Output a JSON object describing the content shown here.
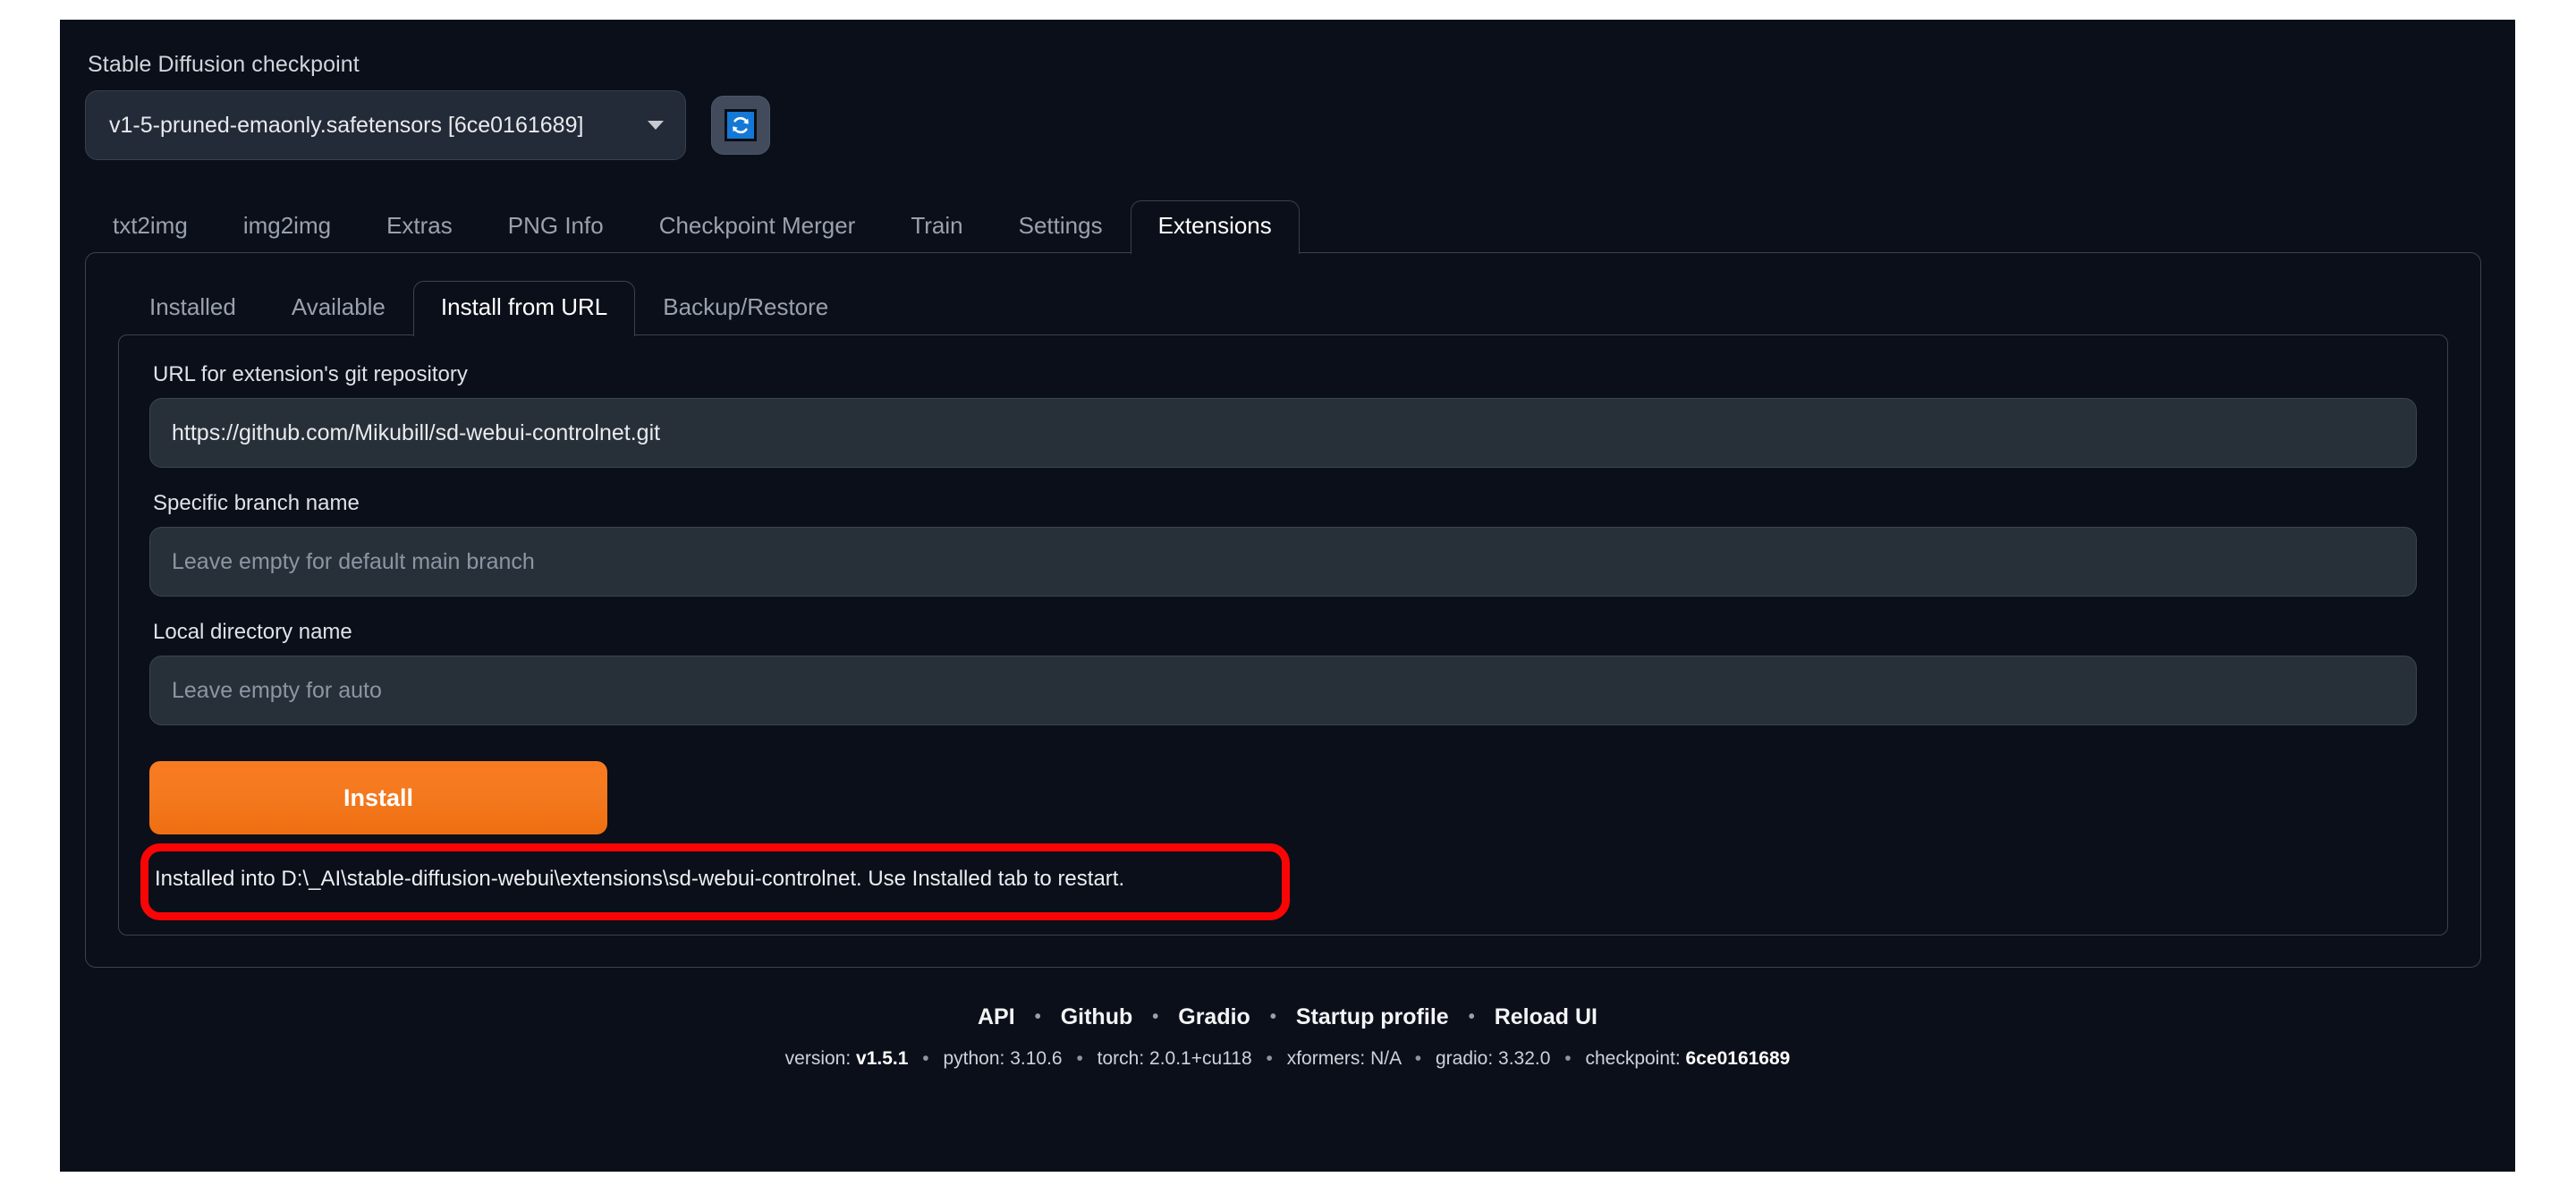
{
  "checkpoint": {
    "label": "Stable Diffusion checkpoint",
    "selected": "v1-5-pruned-emaonly.safetensors [6ce0161689]",
    "refresh_icon": "refresh-icon"
  },
  "main_tabs": [
    {
      "label": "txt2img",
      "active": false
    },
    {
      "label": "img2img",
      "active": false
    },
    {
      "label": "Extras",
      "active": false
    },
    {
      "label": "PNG Info",
      "active": false
    },
    {
      "label": "Checkpoint Merger",
      "active": false
    },
    {
      "label": "Train",
      "active": false
    },
    {
      "label": "Settings",
      "active": false
    },
    {
      "label": "Extensions",
      "active": true
    }
  ],
  "sub_tabs": [
    {
      "label": "Installed",
      "active": false
    },
    {
      "label": "Available",
      "active": false
    },
    {
      "label": "Install from URL",
      "active": true
    },
    {
      "label": "Backup/Restore",
      "active": false
    }
  ],
  "form": {
    "url_field": {
      "label": "URL for extension's git repository",
      "value": "https://github.com/Mikubill/sd-webui-controlnet.git",
      "placeholder": ""
    },
    "branch_field": {
      "label": "Specific branch name",
      "value": "",
      "placeholder": "Leave empty for default main branch"
    },
    "dir_field": {
      "label": "Local directory name",
      "value": "",
      "placeholder": "Leave empty for auto"
    },
    "install_button": "Install"
  },
  "status": {
    "message": "Installed into D:\\_AI\\stable-diffusion-webui\\extensions\\sd-webui-controlnet. Use Installed tab to restart.",
    "highlight_color": "#fa0505"
  },
  "footer": {
    "links": [
      "API",
      "Github",
      "Gradio",
      "Startup profile",
      "Reload UI"
    ],
    "separator": "•",
    "version_items": [
      {
        "key": "version:",
        "value": "v1.5.1",
        "bold": true
      },
      {
        "key": "python:",
        "value": "3.10.6",
        "bold": false
      },
      {
        "key": "torch:",
        "value": "2.0.1+cu118",
        "bold": false
      },
      {
        "key": "xformers:",
        "value": "N/A",
        "bold": false
      },
      {
        "key": "gradio:",
        "value": "3.32.0",
        "bold": false
      },
      {
        "key": "checkpoint:",
        "value": "6ce0161689",
        "bold": true
      }
    ]
  },
  "theme": {
    "background": "#0b0f19",
    "accent_orange": "#f4791f",
    "input_bg": "#273039",
    "border": "#3a4252"
  }
}
